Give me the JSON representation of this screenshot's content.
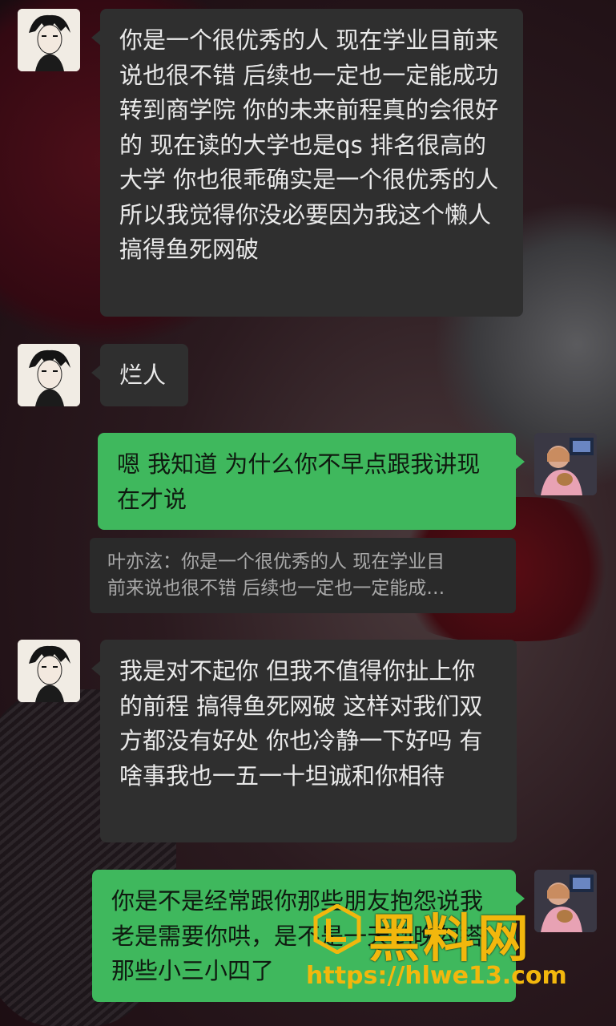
{
  "messages": [
    {
      "side": "left",
      "text": "你是一个很优秀的人 现在学业目前来说也很不错 后续也一定也一定能成功转到商学院 你的未来前程真的会很好的 现在读的大学也是qs 排名很高的大学 你也很乖确实是一个很优秀的人 所以我觉得你没必要因为我这个懒人搞得鱼死网破"
    },
    {
      "side": "left",
      "text": "烂人"
    },
    {
      "side": "right",
      "text": "嗯 我知道 为什么你不早点跟我讲现在才说"
    },
    {
      "quote_line1": "叶亦泫：你是一个很优秀的人 现在学业目",
      "quote_line2": "前来说也很不错 后续也一定也一定能成…"
    },
    {
      "side": "left",
      "text": "我是对不起你 但我不值得你扯上你的前程  搞得鱼死网破 这样对我们双方都没有好处 你也冷静一下好吗 有啥事我也一五一十坦诚和你相待"
    },
    {
      "side": "right",
      "text": "你是不是经常跟你那些朋友抱怨说我老是需要你哄，是不是一天到晚勾搭那些小三小四了"
    }
  ],
  "watermark": {
    "title": "黑料网",
    "url": "https://hlwe13.com"
  },
  "colors": {
    "bubble_dark": "#2f2f2f",
    "bubble_green": "#3fb85d",
    "watermark": "#f2b70d"
  }
}
